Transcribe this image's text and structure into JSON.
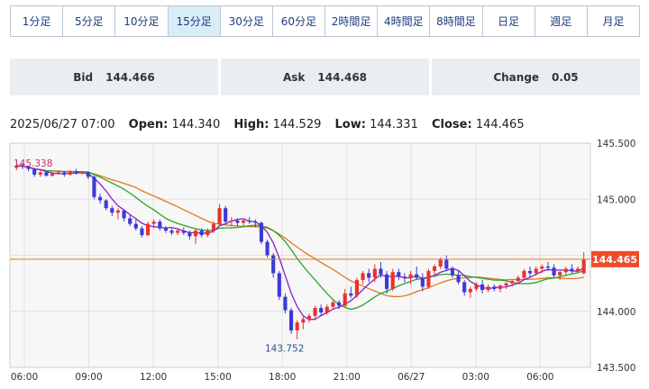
{
  "timeframes": {
    "items": [
      "1分足",
      "5分足",
      "10分足",
      "15分足",
      "30分足",
      "60分足",
      "2時間足",
      "4時間足",
      "8時間足",
      "日足",
      "週足",
      "月足"
    ],
    "active_index": 3
  },
  "quote": {
    "bid_label": "Bid",
    "bid_value": "144.466",
    "ask_label": "Ask",
    "ask_value": "144.468",
    "change_label": "Change",
    "change_value": "0.05"
  },
  "ohlc": {
    "datetime": "2025/06/27 07:00",
    "open_label": "Open:",
    "open_value": "144.340",
    "high_label": "High:",
    "high_value": "144.529",
    "low_label": "Low:",
    "low_value": "144.331",
    "close_label": "Close:",
    "close_value": "144.465"
  },
  "colors": {
    "up": "#e8332e",
    "down": "#3a3ad6",
    "ma_short": "#8a1fc9",
    "ma_mid": "#2aa52a",
    "ma_long": "#e07a1c",
    "price_line": "#e07a1c",
    "price_tag": "#ef4a2b",
    "high_marker": "#c0306a",
    "low_marker": "#2d4f8a"
  },
  "chart_data": {
    "type": "candlestick",
    "interval": "15分足",
    "y_ticks": [
      "145.500",
      "145.000",
      "144.500",
      "144.000",
      "143.500"
    ],
    "ylim": [
      143.5,
      145.5
    ],
    "x_ticks": [
      "06:00",
      "09:00",
      "12:00",
      "15:00",
      "18:00",
      "21:00",
      "06/27",
      "03:00",
      "06:00"
    ],
    "current_price": "144.465",
    "period_high": "145.338",
    "period_low": "143.752",
    "candles_ohlc": [
      [
        145.28,
        145.34,
        145.26,
        145.3
      ],
      [
        145.3,
        145.32,
        145.27,
        145.29
      ],
      [
        145.29,
        145.3,
        145.25,
        145.27
      ],
      [
        145.27,
        145.28,
        145.2,
        145.22
      ],
      [
        145.22,
        145.26,
        145.2,
        145.24
      ],
      [
        145.24,
        145.25,
        145.2,
        145.21
      ],
      [
        145.21,
        145.24,
        145.2,
        145.23
      ],
      [
        145.23,
        145.26,
        145.22,
        145.24
      ],
      [
        145.24,
        145.25,
        145.2,
        145.22
      ],
      [
        145.22,
        145.26,
        145.21,
        145.25
      ],
      [
        145.25,
        145.27,
        145.22,
        145.23
      ],
      [
        145.23,
        145.25,
        145.22,
        145.24
      ],
      [
        145.24,
        145.25,
        145.18,
        145.2
      ],
      [
        145.2,
        145.21,
        145.0,
        145.02
      ],
      [
        145.02,
        145.05,
        144.96,
        144.99
      ],
      [
        144.99,
        145.0,
        144.9,
        144.92
      ],
      [
        144.92,
        144.94,
        144.85,
        144.88
      ],
      [
        144.88,
        144.92,
        144.82,
        144.9
      ],
      [
        144.9,
        144.91,
        144.8,
        144.83
      ],
      [
        144.83,
        144.86,
        144.76,
        144.78
      ],
      [
        144.78,
        144.82,
        144.72,
        144.74
      ],
      [
        144.74,
        144.76,
        144.66,
        144.68
      ],
      [
        144.68,
        144.8,
        144.67,
        144.78
      ],
      [
        144.78,
        144.82,
        144.74,
        144.8
      ],
      [
        144.8,
        144.82,
        144.72,
        144.74
      ],
      [
        144.74,
        144.76,
        144.7,
        144.72
      ],
      [
        144.72,
        144.74,
        144.68,
        144.7
      ],
      [
        144.7,
        144.74,
        144.68,
        144.72
      ],
      [
        144.72,
        144.75,
        144.68,
        144.7
      ],
      [
        144.7,
        144.72,
        144.64,
        144.67
      ],
      [
        144.67,
        144.74,
        144.6,
        144.72
      ],
      [
        144.72,
        144.74,
        144.66,
        144.68
      ],
      [
        144.68,
        144.74,
        144.66,
        144.72
      ],
      [
        144.72,
        144.8,
        144.7,
        144.78
      ],
      [
        144.78,
        144.96,
        144.76,
        144.92
      ],
      [
        144.92,
        144.94,
        144.78,
        144.8
      ],
      [
        144.8,
        144.84,
        144.76,
        144.81
      ],
      [
        144.81,
        144.83,
        144.76,
        144.79
      ],
      [
        144.79,
        144.82,
        144.75,
        144.81
      ],
      [
        144.81,
        144.84,
        144.78,
        144.8
      ],
      [
        144.8,
        144.82,
        144.75,
        144.79
      ],
      [
        144.79,
        144.8,
        144.6,
        144.62
      ],
      [
        144.62,
        144.64,
        144.48,
        144.5
      ],
      [
        144.5,
        144.52,
        144.3,
        144.34
      ],
      [
        144.34,
        144.36,
        144.1,
        144.13
      ],
      [
        144.13,
        144.16,
        143.98,
        144.01
      ],
      [
        144.01,
        144.03,
        143.8,
        143.83
      ],
      [
        143.83,
        143.92,
        143.75,
        143.9
      ],
      [
        143.9,
        143.96,
        143.84,
        143.93
      ],
      [
        143.93,
        143.98,
        143.9,
        143.96
      ],
      [
        143.96,
        144.05,
        143.92,
        144.03
      ],
      [
        144.03,
        144.06,
        143.96,
        143.99
      ],
      [
        143.99,
        144.06,
        143.97,
        144.04
      ],
      [
        144.04,
        144.1,
        144.02,
        144.08
      ],
      [
        144.08,
        144.1,
        144.02,
        144.05
      ],
      [
        144.05,
        144.2,
        144.04,
        144.16
      ],
      [
        144.16,
        144.22,
        144.12,
        144.14
      ],
      [
        144.14,
        144.3,
        144.12,
        144.28
      ],
      [
        144.28,
        144.36,
        144.24,
        144.34
      ],
      [
        144.34,
        144.38,
        144.26,
        144.3
      ],
      [
        144.3,
        144.42,
        144.26,
        144.38
      ],
      [
        144.38,
        144.44,
        144.3,
        144.33
      ],
      [
        144.33,
        144.36,
        144.16,
        144.2
      ],
      [
        144.2,
        144.38,
        144.18,
        144.35
      ],
      [
        144.35,
        144.38,
        144.28,
        144.31
      ],
      [
        144.31,
        144.34,
        144.26,
        144.3
      ],
      [
        144.3,
        144.36,
        144.24,
        144.33
      ],
      [
        144.33,
        144.4,
        144.28,
        144.3
      ],
      [
        144.3,
        144.34,
        144.18,
        144.22
      ],
      [
        144.22,
        144.38,
        144.2,
        144.36
      ],
      [
        144.36,
        144.42,
        144.3,
        144.4
      ],
      [
        144.4,
        144.48,
        144.38,
        144.46
      ],
      [
        144.46,
        144.5,
        144.36,
        144.38
      ],
      [
        144.38,
        144.4,
        144.3,
        144.32
      ],
      [
        144.32,
        144.36,
        144.24,
        144.26
      ],
      [
        144.26,
        144.28,
        144.14,
        144.17
      ],
      [
        144.17,
        144.22,
        144.12,
        144.2
      ],
      [
        144.2,
        144.26,
        144.18,
        144.24
      ],
      [
        144.24,
        144.28,
        144.16,
        144.19
      ],
      [
        144.19,
        144.24,
        144.17,
        144.22
      ],
      [
        144.22,
        144.24,
        144.18,
        144.2
      ],
      [
        144.2,
        144.24,
        144.17,
        144.23
      ],
      [
        144.23,
        144.26,
        144.2,
        144.25
      ],
      [
        144.25,
        144.28,
        144.22,
        144.27
      ],
      [
        144.27,
        144.32,
        144.25,
        144.3
      ],
      [
        144.3,
        144.38,
        144.28,
        144.36
      ],
      [
        144.36,
        144.4,
        144.3,
        144.34
      ],
      [
        144.34,
        144.4,
        144.32,
        144.38
      ],
      [
        144.38,
        144.42,
        144.34,
        144.4
      ],
      [
        144.4,
        144.44,
        144.36,
        144.39
      ],
      [
        144.39,
        144.42,
        144.3,
        144.32
      ],
      [
        144.32,
        144.36,
        144.28,
        144.35
      ],
      [
        144.35,
        144.4,
        144.32,
        144.38
      ],
      [
        144.38,
        144.42,
        144.34,
        144.36
      ],
      [
        144.36,
        144.4,
        144.34,
        144.38
      ],
      [
        144.34,
        144.53,
        144.33,
        144.465
      ]
    ]
  }
}
